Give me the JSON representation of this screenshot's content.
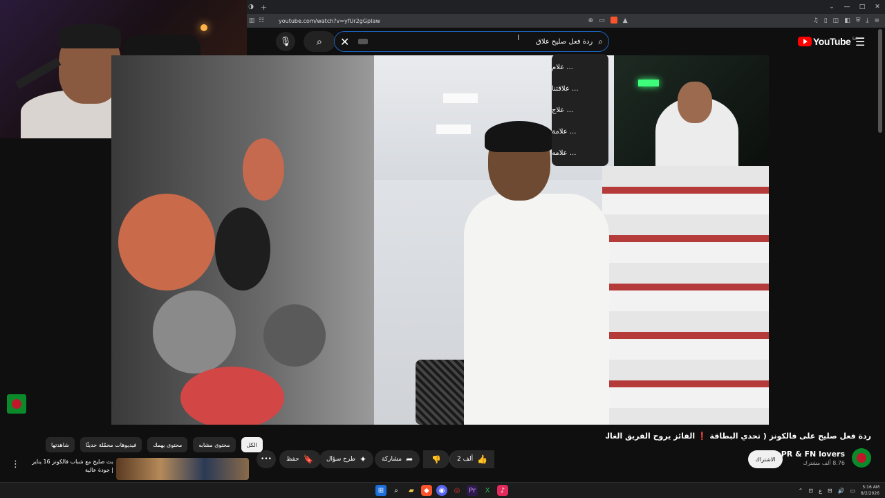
{
  "browser": {
    "url": "youtube.com/watch?v=yfUr2gGpIaw",
    "new_tab_label": "+",
    "window_controls": [
      "⌄",
      "—",
      "□",
      "✕"
    ]
  },
  "youtube": {
    "logo_text": "YouTube",
    "region": "SA",
    "search": {
      "query": "ردة فعل صليح علاق",
      "suggestions": [
        "... علام",
        "... علاقتنا",
        "... علاج",
        "... علامة",
        "... علامه"
      ]
    },
    "video": {
      "title": "ردة فعل صليح على فالكونز ( تحدي البطاقة ❗ الفائز يروح الفريق الغالي 💰🔥 )",
      "channel_name": "PR & FN lovers",
      "channel_subs": "8.76 ألف مشترك",
      "subscribe_label": "الاشتراك",
      "like_count": "2 ألف",
      "share_label": "مشاركة",
      "ask_label": "طرح سؤال",
      "save_label": "حفظ",
      "more_label": "•••"
    },
    "chips": [
      "الكل",
      "محتوى مشابه",
      "محتوى يهمك",
      "فيديوهات محمّلة حديثًا",
      "شاهدتها"
    ],
    "recommendation": {
      "title": "بث صليح مع شباب فالكونز 16 يناير | جودة عالية"
    }
  },
  "taskbar": {
    "time": "5:16 AM",
    "date": "8/2/2026",
    "lang": "ع"
  }
}
